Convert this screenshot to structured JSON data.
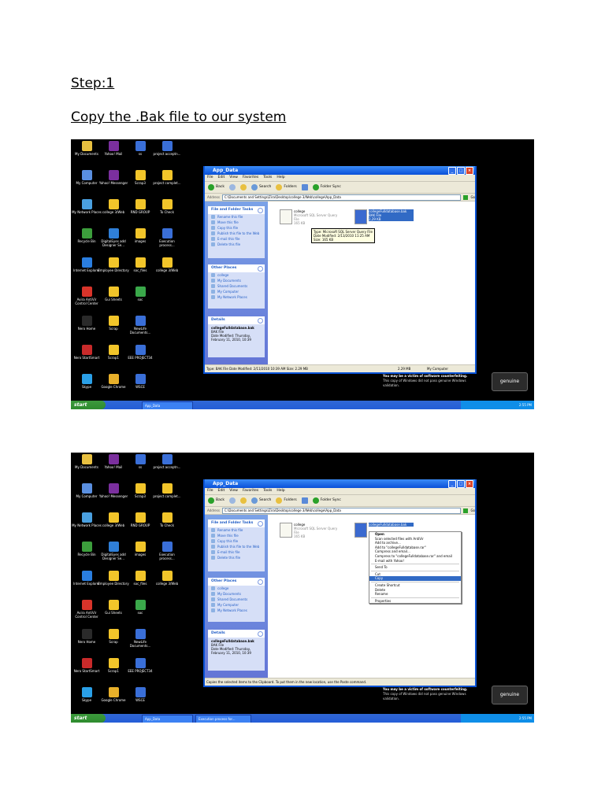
{
  "document": {
    "step_heading": "Step:1",
    "instruction": "Copy the .Bak file to our system"
  },
  "desktop": {
    "icons": [
      {
        "label": "My Documents",
        "color": "#e8c040"
      },
      {
        "label": "Yahoo! Mail",
        "color": "#7b2f9e"
      },
      {
        "label": "ss",
        "color": "#3a6fd8"
      },
      {
        "label": "project acceptn...",
        "color": "#3a6fd8"
      },
      {
        "label": "My Computer",
        "color": "#5a8fe0"
      },
      {
        "label": "Yahoo! Messenger",
        "color": "#7b2f9e"
      },
      {
        "label": "Scrap3",
        "color": "#f2c52a"
      },
      {
        "label": "project complet...",
        "color": "#f2c52a"
      },
      {
        "label": "My Network Places",
        "color": "#4aa0e0"
      },
      {
        "label": "college 3/Web",
        "color": "#f2c52a"
      },
      {
        "label": "RND GROUP",
        "color": "#f2c52a"
      },
      {
        "label": "To Check",
        "color": "#f2c52a"
      },
      {
        "label": "Recycle Bin",
        "color": "#3c9e3c"
      },
      {
        "label": "DigitalEyes add Designer Se...",
        "color": "#2f7fd8"
      },
      {
        "label": "images",
        "color": "#f2c52a"
      },
      {
        "label": "Execution process...",
        "color": "#3a6fd8"
      },
      {
        "label": "Internet Explorer",
        "color": "#2a7ee0"
      },
      {
        "label": "Employee Directory",
        "color": "#f2c52a"
      },
      {
        "label": "soc_files",
        "color": "#f2c52a"
      },
      {
        "label": "college 3/Web",
        "color": "#f2c52a"
      },
      {
        "label": "Avira AntiVir Control Center",
        "color": "#d8342a"
      },
      {
        "label": "Gui Sheets",
        "color": "#f2c52a"
      },
      {
        "label": "soc",
        "color": "#3aa84a"
      },
      {
        "label": "",
        "color": "#000"
      },
      {
        "label": "Nero Home",
        "color": "#2a2a2a"
      },
      {
        "label": "Scrap",
        "color": "#f2c52a"
      },
      {
        "label": "NewLife Documents...",
        "color": "#3a6fd8"
      },
      {
        "label": "",
        "color": "#000"
      },
      {
        "label": "Nero StartSmart",
        "color": "#c82a2a"
      },
      {
        "label": "Scrap1",
        "color": "#f2c52a"
      },
      {
        "label": "EEE PROJECT34",
        "color": "#3a6fd8"
      },
      {
        "label": "",
        "color": "#000"
      },
      {
        "label": "Skype",
        "color": "#2aa0e8"
      },
      {
        "label": "Google Chrome",
        "color": "#e8b02a"
      },
      {
        "label": "WSCE",
        "color": "#3a6fd8"
      }
    ],
    "genuine_lines": [
      "You may be a victim of software counterfeiting.",
      "This copy of Windows did not pass genuine Windows",
      "validation."
    ],
    "genuine_badge": "genuine",
    "taskbar": {
      "start": "start",
      "clock": "2:55 PM"
    }
  },
  "window": {
    "title": "App_Data",
    "menu": [
      "File",
      "Edit",
      "View",
      "Favorites",
      "Tools",
      "Help"
    ],
    "toolbar": [
      "Back",
      "Search",
      "Folders",
      "Folder Sync"
    ],
    "address_label": "Address",
    "address_path": "C:\\Documents and Settings\\Zira\\Desktop\\college 3/Web\\college\\App_Data",
    "go": "Go",
    "file_tasks_title": "File and Folder Tasks",
    "file_tasks": [
      "Rename this file",
      "Move this file",
      "Copy this file",
      "Publish this file to the Web",
      "E-mail this file",
      "Delete this file"
    ],
    "other_places_title": "Other Places",
    "other_places": [
      "college",
      "My Documents",
      "Shared Documents",
      "My Computer",
      "My Network Places"
    ],
    "details_title": "Details",
    "details": {
      "name": "collegeFulldatabase.bak",
      "type": "BAK File",
      "modified": "Date Modified: Thursday, February 11, 2010, 10:39"
    },
    "files": [
      {
        "name": "college",
        "type": "Microsoft SQL Server Query File",
        "size": "165 KB"
      },
      {
        "name": "collegeFulldatabase.bak",
        "type": "BAK File",
        "size": "2,29 KB"
      }
    ]
  },
  "screenshot1": {
    "taskbar_item": "App_Data",
    "tooltip": [
      "Type: Microsoft SQL Server Query File",
      "Date Modified: 2/13/2010 11:25 AM",
      "Size: 165 KB"
    ],
    "status_left": "Type: BAK File Date Modified: 2/11/2010 10:39 AM Size: 2.29 MB",
    "status_size": "2.29 MB",
    "status_zone": "My Computer"
  },
  "screenshot2": {
    "taskbar_items": [
      "App_Data",
      "Execution process for..."
    ],
    "status_left": "Copies the selected items to the Clipboard. To put them in the new location, use the Paste command.",
    "context_menu": [
      "Open",
      "Scan selected files with AntiVir",
      "Add to archive...",
      "Add to \"collegeFulldatabase.rar\"",
      "Compress and email...",
      "Compress to \"collegeFulldatabase.rar\" and email",
      "E-mail with Yahoo!",
      "Send To",
      "Cut",
      "Copy",
      "Create Shortcut",
      "Delete",
      "Rename",
      "Properties"
    ]
  }
}
